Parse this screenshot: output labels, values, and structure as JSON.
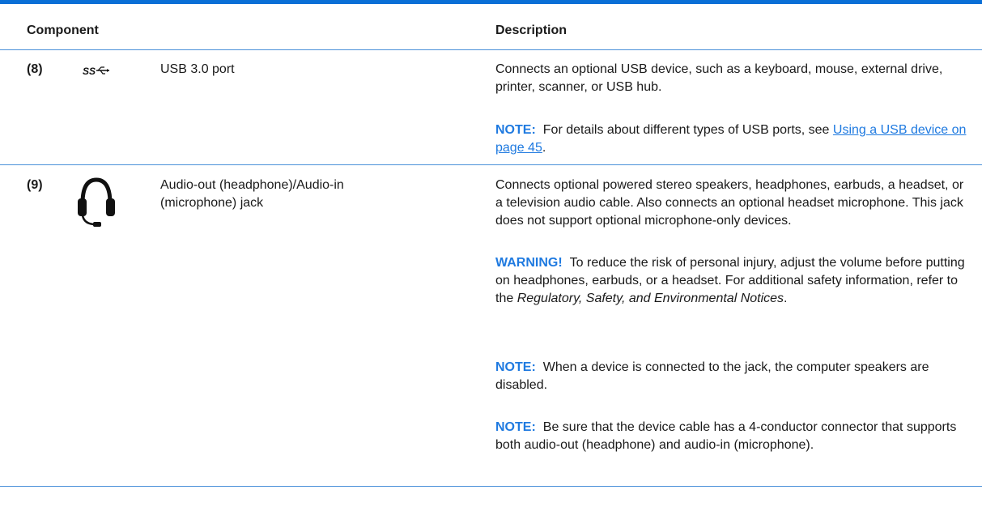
{
  "header": {
    "component": "Component",
    "description": "Description"
  },
  "rows": [
    {
      "number": "(8)",
      "icon": "usb-ss-icon",
      "name": "USB 3.0 port",
      "description": "Connects an optional USB device, such as a keyboard, mouse, external drive, printer, scanner, or USB hub.",
      "note": {
        "label": "NOTE:",
        "text": "For details about different types of USB ports, see ",
        "link": "Using a USB device on page 45",
        "after": "."
      }
    },
    {
      "number": "(9)",
      "icon": "headset-icon",
      "name_line1": "Audio-out (headphone)/Audio-in",
      "name_line2": "(microphone) jack",
      "description": "Connects optional powered stereo speakers, headphones, earbuds, a headset, or a television audio cable. Also connects an optional headset microphone. This jack does not support optional microphone-only devices.",
      "warning": {
        "label": "WARNING!",
        "text": "To reduce the risk of personal injury, adjust the volume before putting on headphones, earbuds, or a headset. For additional safety information, refer to the ",
        "italic": "Regulatory, Safety, and Environmental Notices",
        "after": "."
      },
      "note1": {
        "label": "NOTE:",
        "text": "When a device is connected to the jack, the computer speakers are disabled."
      },
      "note2": {
        "label": "NOTE:",
        "text": "Be sure that the device cable has a 4-conductor connector that supports both audio-out (headphone) and audio-in (microphone)."
      }
    }
  ]
}
